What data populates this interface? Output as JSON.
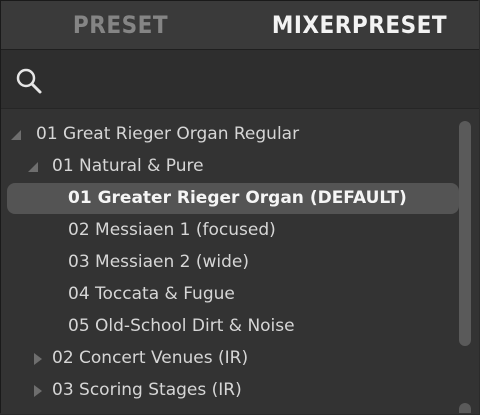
{
  "tabs": [
    {
      "label": "PRESET",
      "active": false
    },
    {
      "label": "MIXERPRESET",
      "active": true
    }
  ],
  "search": {
    "icon": "search-icon",
    "value": "",
    "placeholder": ""
  },
  "tree": {
    "items": [
      {
        "label": "01 Great Rieger Organ Regular",
        "level": 0,
        "expanded": true
      },
      {
        "label": "01 Natural & Pure",
        "level": 1,
        "expanded": true
      },
      {
        "label": "01 Greater Rieger Organ (DEFAULT)",
        "level": 2,
        "selected": true
      },
      {
        "label": "02 Messiaen 1 (focused)",
        "level": 2
      },
      {
        "label": "03 Messiaen 2 (wide)",
        "level": 2
      },
      {
        "label": "04 Toccata & Fugue",
        "level": 2
      },
      {
        "label": "05 Old-School Dirt & Noise",
        "level": 2
      },
      {
        "label": "02 Concert Venues (IR)",
        "level": 1,
        "expanded": false
      },
      {
        "label": "03 Scoring Stages (IR)",
        "level": 1,
        "expanded": false
      }
    ]
  },
  "colors": {
    "background": "#333333",
    "selected_row": "#545454",
    "text": "#d6d6d6"
  }
}
